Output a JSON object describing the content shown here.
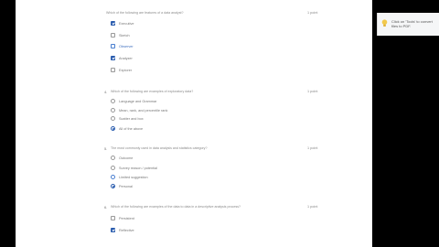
{
  "questions": [
    {
      "number": "",
      "prompt": "Which of the following are features of a data analyst?",
      "points": "1 point",
      "type": "checkbox",
      "options": [
        {
          "label": "Executive",
          "checked": true,
          "hint": false
        },
        {
          "label": "Sketch",
          "checked": false,
          "hint": false
        },
        {
          "label": "Observer",
          "checked": false,
          "hint": true
        },
        {
          "label": "Analyzer",
          "checked": true,
          "hint": false
        },
        {
          "label": "Explorer",
          "checked": false,
          "hint": false
        }
      ]
    },
    {
      "number": "4.",
      "prompt": "Which of the following are examples of exploratory data?",
      "points": "1 point",
      "type": "radio",
      "options": [
        {
          "label": "Language and Grammar",
          "checked": false,
          "hint": false
        },
        {
          "label": "Mean, rank, and percentile rank",
          "checked": false,
          "hint": false
        },
        {
          "label": "Scatter and box",
          "checked": false,
          "hint": false
        },
        {
          "label": "All of the above",
          "checked": true,
          "hint": false
        }
      ]
    },
    {
      "number": "5.",
      "prompt": "The most commonly used in data analysis and statistics category?",
      "points": "1 point",
      "type": "radio",
      "options": [
        {
          "label": "Outcome",
          "checked": false,
          "hint": false
        },
        {
          "label": "Survey reason / potential",
          "checked": false,
          "hint": false
        },
        {
          "label": "Limited suggestion",
          "checked": false,
          "hint": true
        },
        {
          "label": "Personal",
          "checked": true,
          "hint": false
        }
      ]
    },
    {
      "number": "6.",
      "prompt": "Which of the following are examples of the data to data in a descriptive analysis process?",
      "points": "1 point",
      "type": "checkbox",
      "options": [
        {
          "label": "Persistent",
          "checked": false,
          "hint": false
        },
        {
          "label": "Reflective",
          "checked": true,
          "hint": false
        }
      ]
    }
  ],
  "toast": {
    "line1": "Click on 'Tools' to convert",
    "line2": "files to PDF."
  },
  "colors": {
    "accent": "#2a5cae",
    "toast_icon": "#f2c94c"
  }
}
